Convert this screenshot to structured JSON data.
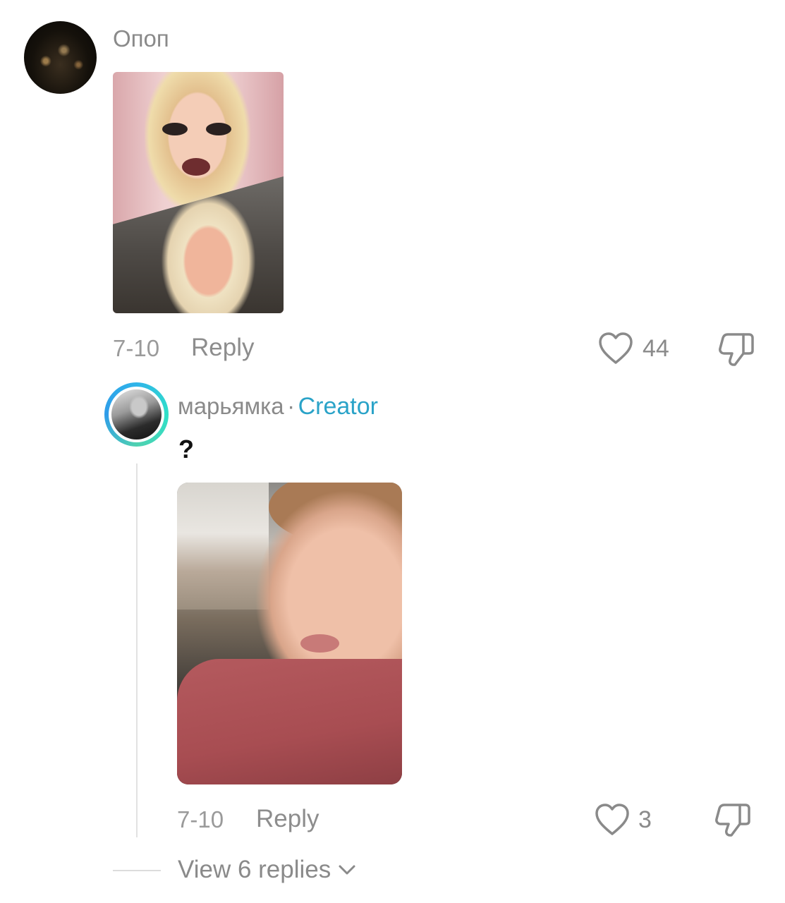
{
  "comment": {
    "username": "Опоп",
    "date": "7-10",
    "reply_label": "Reply",
    "like_count": "44"
  },
  "reply": {
    "username": "марьямка",
    "separator": "·",
    "creator_badge": "Creator",
    "text": "?",
    "date": "7-10",
    "reply_label": "Reply",
    "like_count": "3"
  },
  "view_replies": {
    "label": "View 6 replies"
  },
  "icons": {
    "like": "heart-icon",
    "dislike": "thumbs-down-icon",
    "expand": "chevron-down-icon"
  },
  "colors": {
    "creator": "#2aa3c8",
    "meta_text": "#8a8a8a"
  }
}
